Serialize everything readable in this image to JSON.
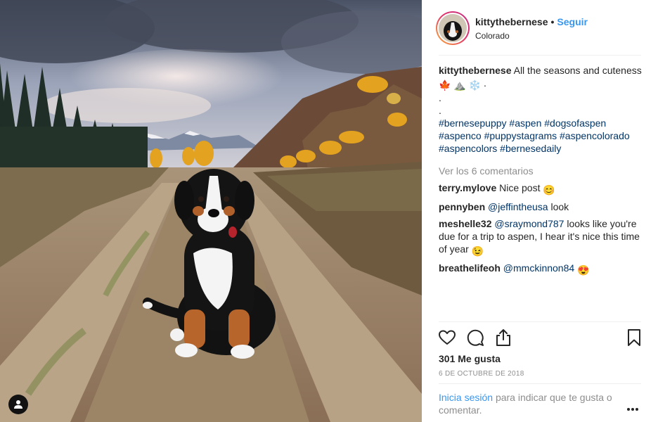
{
  "post": {
    "username": "kittythebernese",
    "dot": "•",
    "follow_label": "Seguir",
    "location": "Colorado"
  },
  "caption": {
    "username": "kittythebernese",
    "text": "All the seasons and cuteness",
    "emoji": [
      "🍁",
      "⛰️",
      "❄️"
    ],
    "trailing": ".",
    "dot_line_1": ".",
    "dot_line_2": ".",
    "hashtags": [
      "#bernesepuppy",
      "#aspen",
      "#dogsofaspen",
      "#aspenco",
      "#puppystagrams",
      "#aspencolorado",
      "#aspencolors",
      "#bernesedaily"
    ]
  },
  "view_all_comments": "Ver los 6 comentarios",
  "comments": [
    {
      "user": "terry.mylove",
      "text": "Nice post",
      "emoji": "😊"
    },
    {
      "user": "pennyben",
      "mention": "@jeffinthеusa",
      "text": "look"
    },
    {
      "user": "meshelle32",
      "mention": "@sraymond787",
      "text": "looks like you're due for a trip to aspen, I hear it's nice this time of year",
      "emoji": "😉"
    },
    {
      "user": "breathelifeoh",
      "mention": "@mmckinnon84",
      "emoji": "😍"
    }
  ],
  "likes": "301 Me gusta",
  "date": "6 DE OCTUBRE DE 2018",
  "login_prompt": {
    "link": "Inicia sesión",
    "text": "para indicar que te gusta o comentar."
  },
  "icons": {
    "like": "heart-icon",
    "comment": "comment-icon",
    "share": "share-icon",
    "save": "bookmark-icon",
    "more": "more-options-icon",
    "user_tag": "user-tag-icon"
  },
  "colors": {
    "follow": "#3897f0",
    "mention": "#003569",
    "muted": "#8e8e8e",
    "text": "#262626",
    "divider": "#efefef"
  }
}
